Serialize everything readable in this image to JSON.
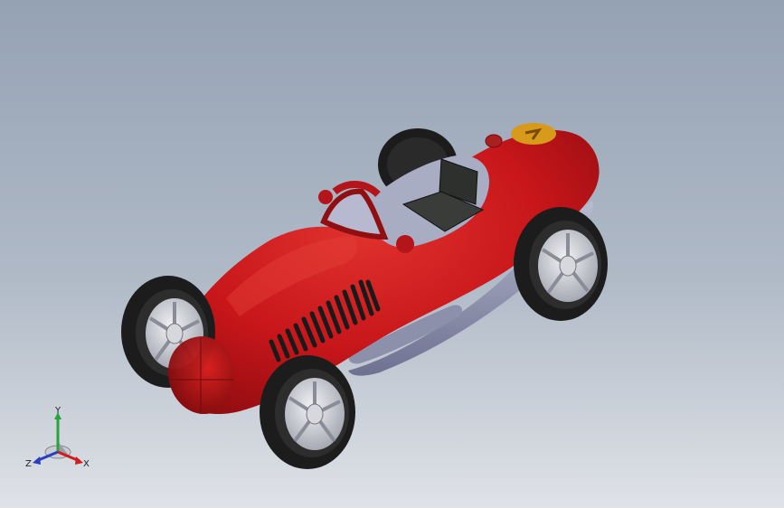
{
  "viewport": {
    "background_top": "#95a2b4",
    "background_bottom": "#dfe2e7"
  },
  "model": {
    "body_color": "#c8161a",
    "badge_color": "#d89a1a",
    "seat_color": "#2e302e",
    "underbody_color": "#9aa0b8",
    "tire_color": "#1c1c1c",
    "rim_color": "#c9ccd4"
  },
  "triad": {
    "x_label": "X",
    "y_label": "Y",
    "z_label": "Z",
    "x_color": "#d21b1b",
    "y_color": "#27a43a",
    "z_color": "#2a3fbf"
  }
}
